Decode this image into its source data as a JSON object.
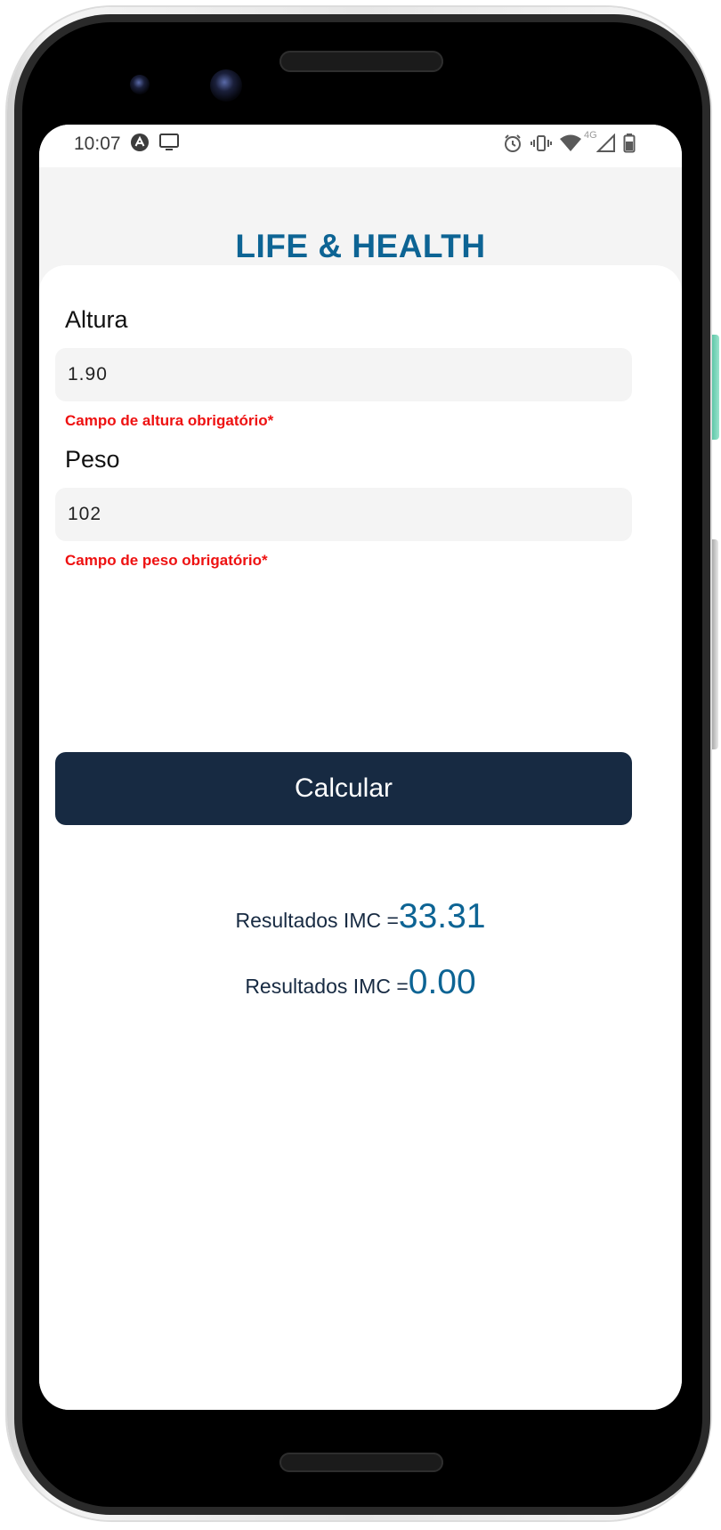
{
  "status_bar": {
    "time": "10:07",
    "left_icons": [
      "app-notification-icon",
      "cast-screen-icon"
    ],
    "right_icons": [
      "alarm-icon",
      "vibrate-icon",
      "wifi-icon",
      "4g-signal-icon",
      "battery-icon"
    ],
    "network_label": "4G"
  },
  "app": {
    "title": "LIFE & HEALTH"
  },
  "form": {
    "height_label": "Altura",
    "height_value": "1.90",
    "height_error": "Campo de altura obrigatório*",
    "weight_label": "Peso",
    "weight_value": "102",
    "weight_error": "Campo de peso obrigatório*",
    "calculate_label": "Calcular"
  },
  "results": [
    {
      "label": "Resultados IMC =",
      "value": "33.31"
    },
    {
      "label": "Resultados IMC =",
      "value": "0.00"
    }
  ],
  "colors": {
    "title": "#0d6494",
    "button": "#172a42",
    "error": "#ee1111",
    "input_bg": "#f4f4f4"
  }
}
